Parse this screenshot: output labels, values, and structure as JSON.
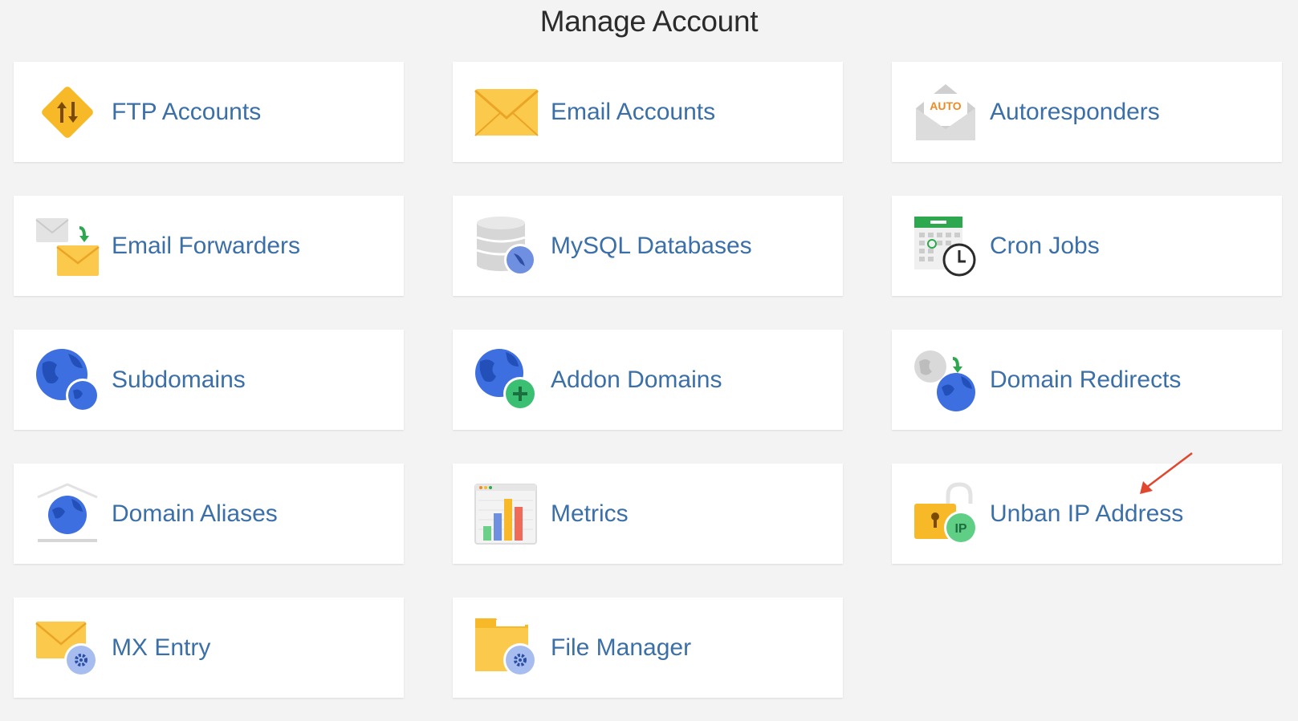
{
  "page": {
    "title": "Manage Account"
  },
  "colors": {
    "label": "#3b6fa8",
    "title": "#2b2b2b",
    "background": "#f3f3f3",
    "card": "#ffffff",
    "annotation_arrow": "#e0472e"
  },
  "tiles": [
    {
      "label": "FTP Accounts",
      "icon": "ftp-arrows-icon"
    },
    {
      "label": "Email Accounts",
      "icon": "envelope-icon"
    },
    {
      "label": "Autoresponders",
      "icon": "auto-envelope-icon",
      "icon_text": "AUTO"
    },
    {
      "label": "Email Forwarders",
      "icon": "forward-envelope-icon"
    },
    {
      "label": "MySQL Databases",
      "icon": "database-icon"
    },
    {
      "label": "Cron Jobs",
      "icon": "calendar-clock-icon"
    },
    {
      "label": "Subdomains",
      "icon": "globe-pair-icon"
    },
    {
      "label": "Addon Domains",
      "icon": "globe-add-icon"
    },
    {
      "label": "Domain Redirects",
      "icon": "globe-redirect-icon"
    },
    {
      "label": "Domain Aliases",
      "icon": "globe-house-icon"
    },
    {
      "label": "Metrics",
      "icon": "bar-chart-icon"
    },
    {
      "label": "Unban IP Address",
      "icon": "unlock-ip-icon",
      "icon_text": "IP"
    },
    {
      "label": "MX Entry",
      "icon": "envelope-gear-icon"
    },
    {
      "label": "File Manager",
      "icon": "folder-gear-icon"
    }
  ]
}
